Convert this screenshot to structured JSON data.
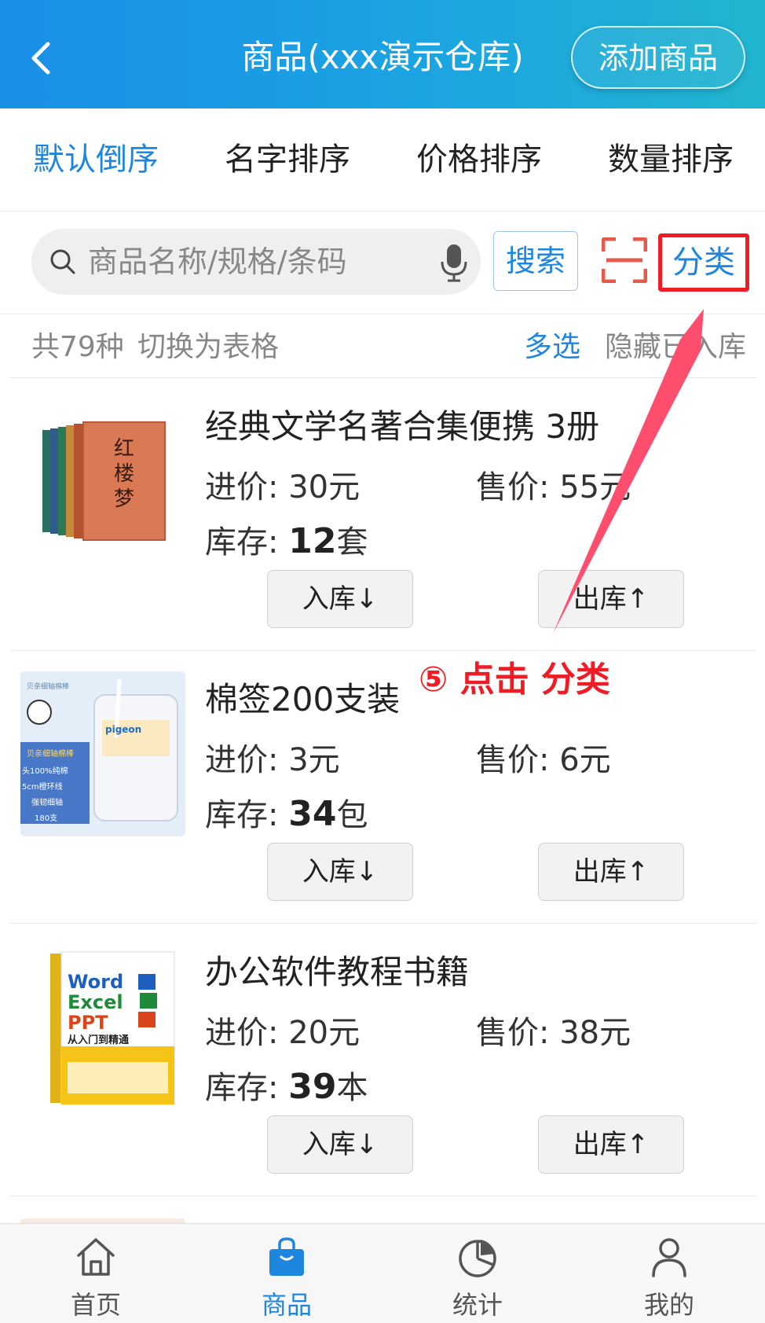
{
  "header": {
    "title": "商品(xxx演示仓库)",
    "add_button": "添加商品",
    "back_icon": "chevron-left-icon"
  },
  "sort_tabs": [
    {
      "label": "默认倒序",
      "active": true
    },
    {
      "label": "名字排序",
      "active": false
    },
    {
      "label": "价格排序",
      "active": false
    },
    {
      "label": "数量排序",
      "active": false
    }
  ],
  "search": {
    "placeholder": "商品名称/规格/条码",
    "value": "",
    "search_button": "搜索",
    "category_button": "分类"
  },
  "info": {
    "total": "共79种",
    "switch_view": "切换为表格",
    "multi_select": "多选",
    "hide": "隐藏已入库"
  },
  "products": [
    {
      "name": "经典文学名著合集便携  3册",
      "buy_label": "进价:",
      "buy_value": "30元",
      "sell_label": "售价:",
      "sell_value": "55元",
      "stock_label": "库存:",
      "stock_qty": "12",
      "stock_unit": "套",
      "in_button": "入库↓",
      "out_button": "出库↑",
      "image": "book-set-hongloumeng"
    },
    {
      "name": "棉签200支装",
      "buy_label": "进价:",
      "buy_value": "3元",
      "sell_label": "售价:",
      "sell_value": "6元",
      "stock_label": "库存:",
      "stock_qty": "34",
      "stock_unit": "包",
      "in_button": "入库↓",
      "out_button": "出库↑",
      "image": "cotton-swab-box",
      "image_text": [
        "贝亲细轴棉棒",
        "头100%纯棉",
        "5cm橙环线",
        "强韧细轴",
        "180支",
        "pigeon"
      ]
    },
    {
      "name": "办公软件教程书籍",
      "buy_label": "进价:",
      "buy_value": "20元",
      "sell_label": "售价:",
      "sell_value": "38元",
      "stock_label": "库存:",
      "stock_qty": "39",
      "stock_unit": "本",
      "in_button": "入库↓",
      "out_button": "出库↑",
      "image": "office-book-cover",
      "image_text": [
        "Word",
        "Excel",
        "PPT",
        "从入门到精通"
      ]
    }
  ],
  "annotation": "⑤ 点击 分类",
  "colors": {
    "accent": "#1f86e0",
    "highlight": "#ee1c25",
    "header_start": "#1a8fe6",
    "header_end": "#21b5cf",
    "arrow": "#ff4d6d"
  },
  "tabbar": [
    {
      "label": "首页",
      "icon": "home-icon",
      "active": false
    },
    {
      "label": "商品",
      "icon": "shopping-bag-icon",
      "active": true
    },
    {
      "label": "统计",
      "icon": "pie-chart-icon",
      "active": false
    },
    {
      "label": "我的",
      "icon": "user-icon",
      "active": false
    }
  ]
}
